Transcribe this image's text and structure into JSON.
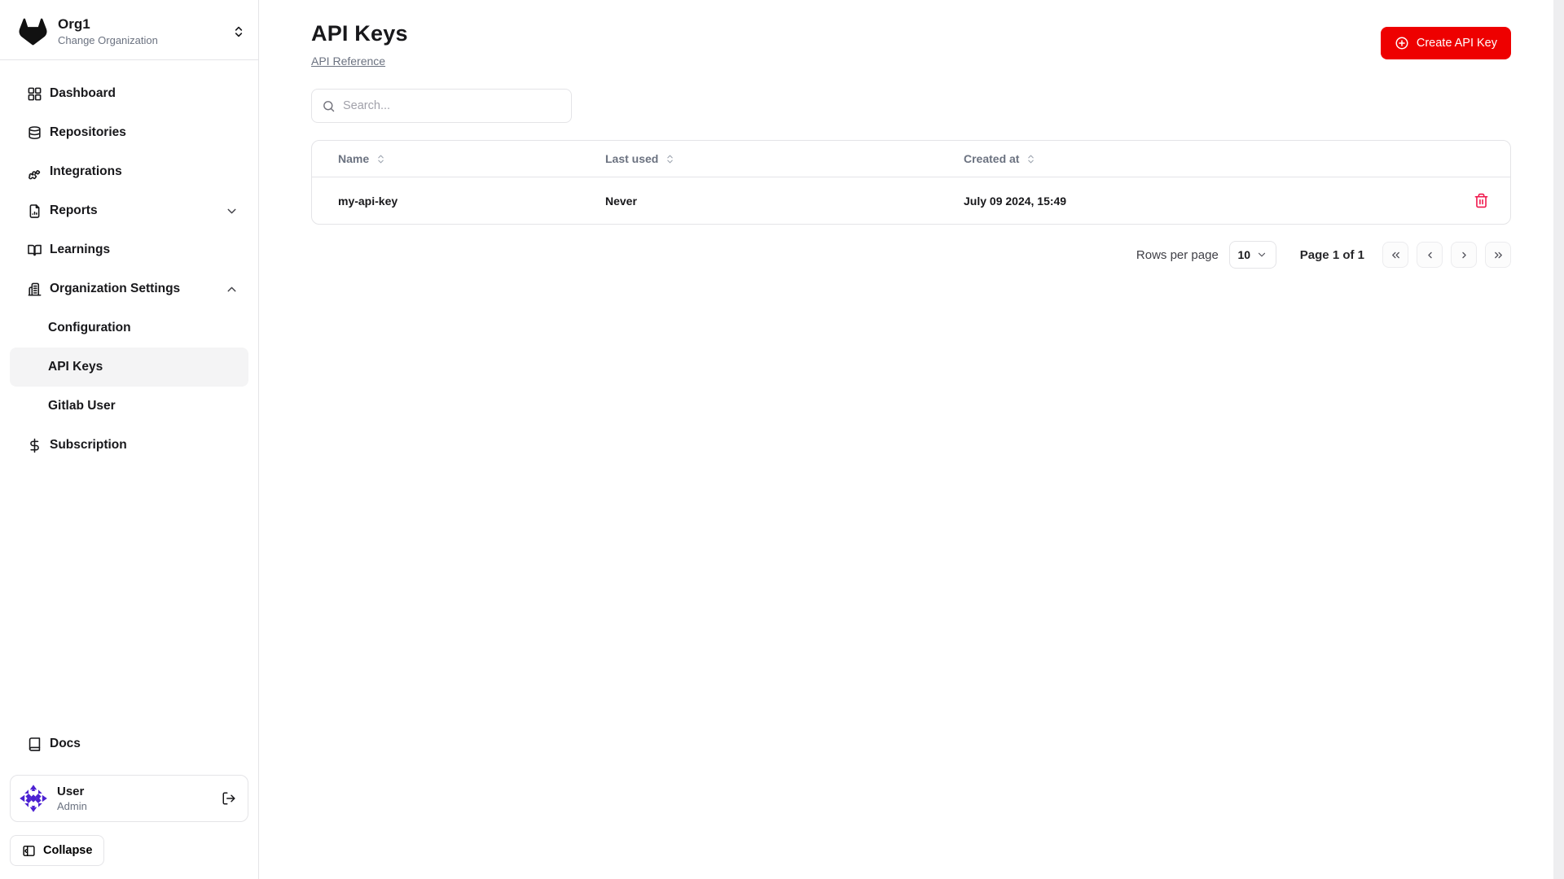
{
  "sidebar": {
    "org": {
      "name": "Org1",
      "subtitle": "Change Organization"
    },
    "items": [
      {
        "label": "Dashboard"
      },
      {
        "label": "Repositories"
      },
      {
        "label": "Integrations"
      },
      {
        "label": "Reports"
      },
      {
        "label": "Learnings"
      },
      {
        "label": "Organization Settings"
      }
    ],
    "sub_items": [
      {
        "label": "Configuration"
      },
      {
        "label": "API Keys"
      },
      {
        "label": "Gitlab User"
      }
    ],
    "subscription_label": "Subscription",
    "docs_label": "Docs",
    "user": {
      "name": "User",
      "role": "Admin"
    },
    "collapse_label": "Collapse"
  },
  "main": {
    "title": "API Keys",
    "reference_link": "API Reference",
    "search_placeholder": "Search...",
    "create_button_label": "Create API Key",
    "table": {
      "columns": [
        "Name",
        "Last used",
        "Created at"
      ],
      "rows": [
        {
          "name": "my-api-key",
          "last_used": "Never",
          "created_at": "July 09 2024, 15:49"
        }
      ]
    },
    "pagination": {
      "rows_per_page_label": "Rows per page",
      "rows_per_page_value": "10",
      "page_info": "Page 1 of 1"
    }
  },
  "colors": {
    "accent_red": "#ee0000",
    "danger_rose": "#f0164b",
    "avatar_purple": "#4c21d2",
    "active_item_bg": "#f4f4f5",
    "border": "#e4e4e7",
    "muted_text": "#6b7280"
  }
}
